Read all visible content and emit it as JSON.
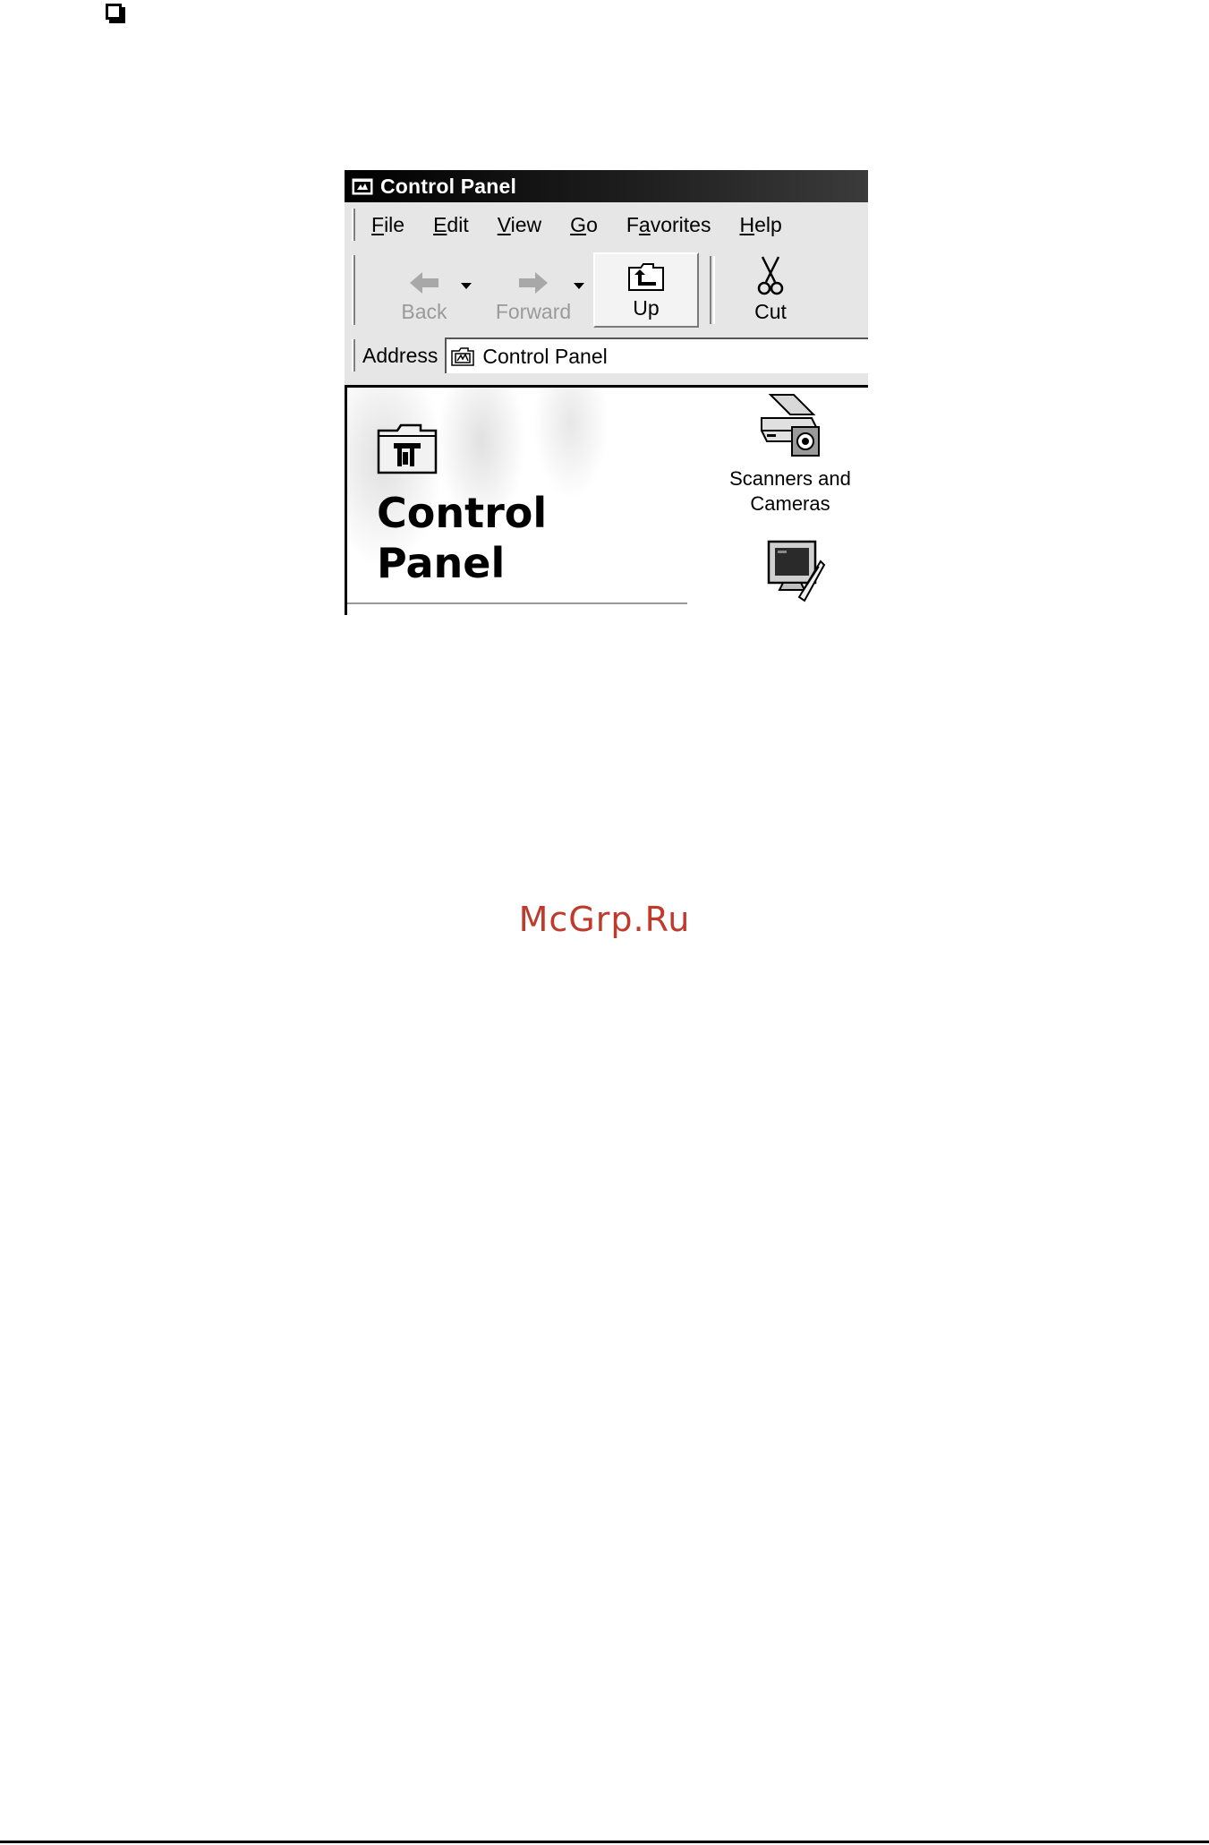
{
  "window": {
    "title": "Control Panel"
  },
  "menu": [
    {
      "pre": "",
      "key": "F",
      "post": "ile"
    },
    {
      "pre": "",
      "key": "E",
      "post": "dit"
    },
    {
      "pre": "",
      "key": "V",
      "post": "iew"
    },
    {
      "pre": "",
      "key": "G",
      "post": "o"
    },
    {
      "pre": "F",
      "key": "a",
      "post": "vorites"
    },
    {
      "pre": "",
      "key": "H",
      "post": "elp"
    }
  ],
  "toolbar": {
    "back_label": "Back",
    "forward_label": "Forward",
    "up_label": "Up",
    "cut_label": "Cut"
  },
  "address": {
    "label": "Address",
    "value": "Control Panel"
  },
  "content": {
    "heading_line1": "Control",
    "heading_line2": "Panel",
    "items": [
      {
        "label_line1": "Scanners and",
        "label_line2": "Cameras",
        "icon": "scanner-icon"
      },
      {
        "label_line1": "",
        "label_line2": "",
        "icon": "display-icon"
      }
    ]
  },
  "watermark": "McGrp.Ru",
  "colors": {
    "titlebar": "#000000",
    "watermark": "#c0392b",
    "chrome": "#e6e6e6"
  }
}
